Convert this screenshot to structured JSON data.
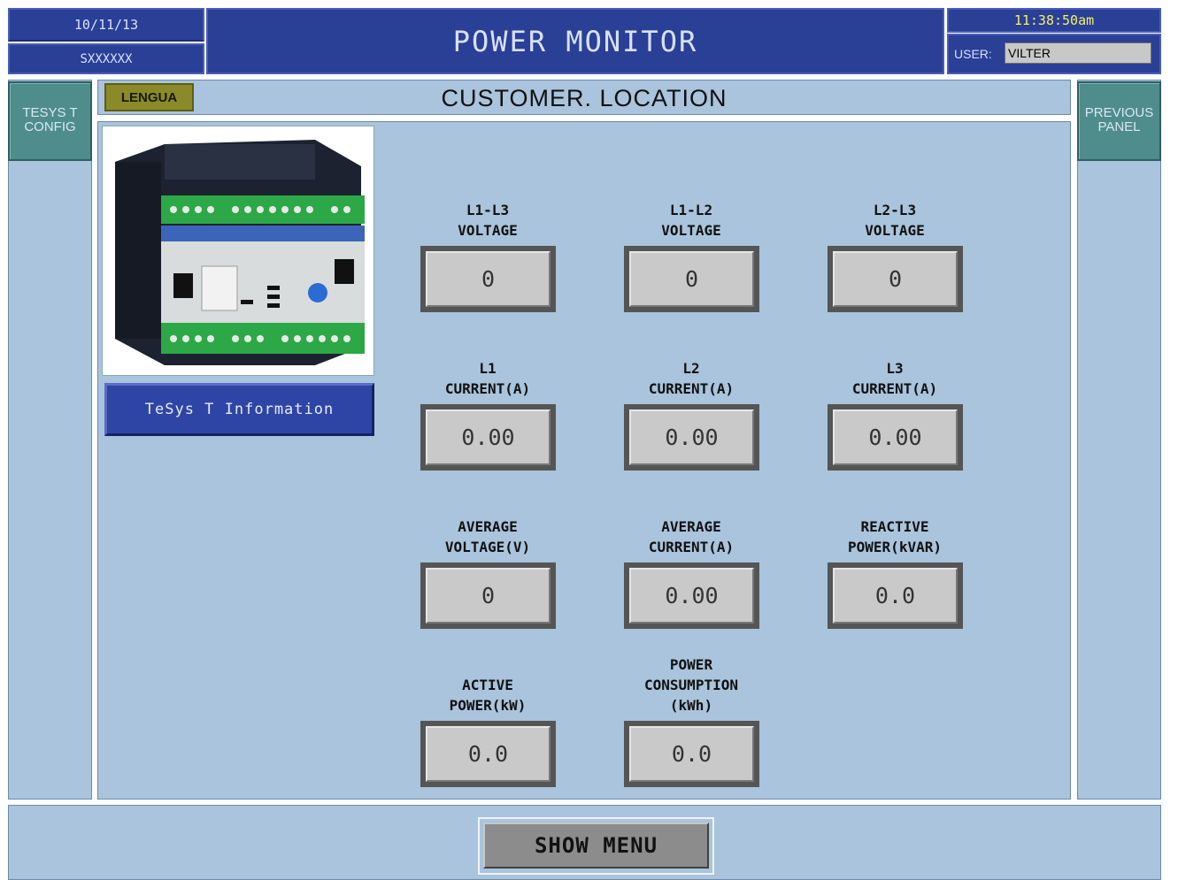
{
  "header": {
    "date": "10/11/13",
    "serial": "SXXXXXX",
    "title": "POWER MONITOR",
    "time": "11:38:50am",
    "user_label": "USER:",
    "user_value": "VILTER"
  },
  "nav": {
    "left_button": "TESYS T\nCONFIG",
    "right_button": "PREVIOUS\nPANEL",
    "lengua": "LENGUA",
    "location": "CUSTOMER. LOCATION",
    "tesys_info": "TeSys T Information",
    "show_menu": "SHOW MENU"
  },
  "readings": [
    {
      "label": "L1-L3\nVOLTAGE",
      "value": "0"
    },
    {
      "label": "L1-L2\nVOLTAGE",
      "value": "0"
    },
    {
      "label": "L2-L3\nVOLTAGE",
      "value": "0"
    },
    {
      "label": "L1\nCURRENT(A)",
      "value": "0.00"
    },
    {
      "label": "L2\nCURRENT(A)",
      "value": "0.00"
    },
    {
      "label": "L3\nCURRENT(A)",
      "value": "0.00"
    },
    {
      "label": "AVERAGE\nVOLTAGE(V)",
      "value": "0"
    },
    {
      "label": "AVERAGE\nCURRENT(A)",
      "value": "0.00"
    },
    {
      "label": "REACTIVE\nPOWER(kVAR)",
      "value": "0.0"
    },
    {
      "label": "ACTIVE\nPOWER(kW)",
      "value": "0.0"
    },
    {
      "label": "POWER\nCONSUMPTION\n(kWh)",
      "value": "0.0"
    }
  ],
  "colors": {
    "panel_bg": "#a9c4dc",
    "header_bg": "#2a3f96",
    "time_text": "#f5f06a",
    "side_button": "#4e8d8c",
    "lengua_button": "#8a8a2a"
  }
}
